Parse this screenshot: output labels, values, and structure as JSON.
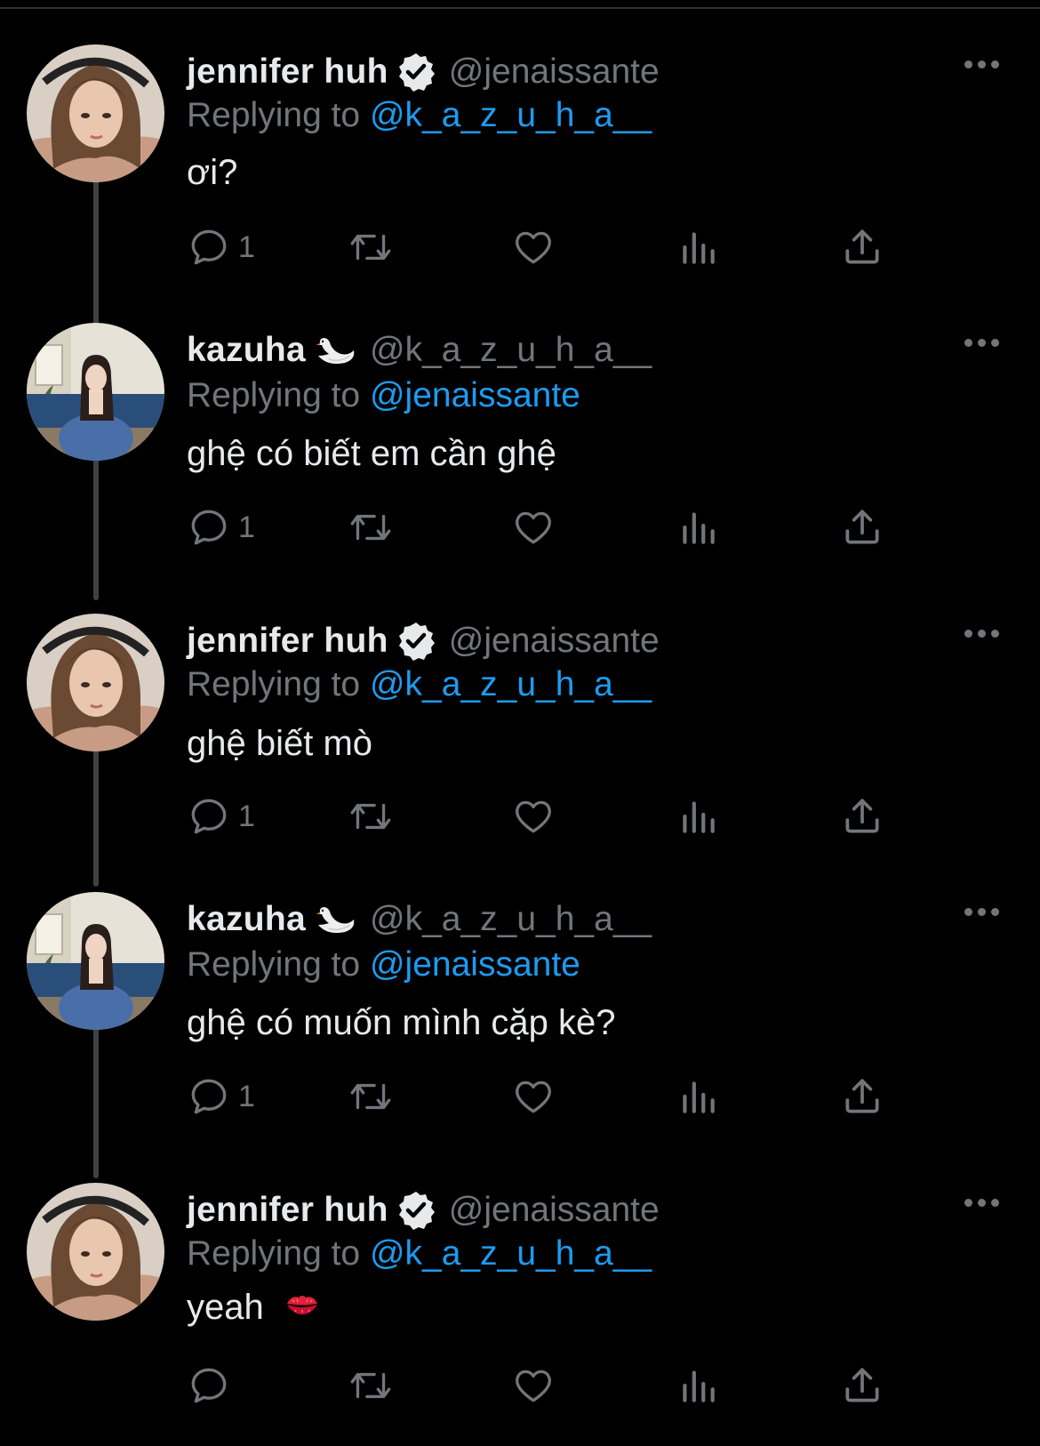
{
  "colors": {
    "background": "#000000",
    "text": "#e7e9ea",
    "muted": "#71767b",
    "accent": "#1d9bf0",
    "thread": "#3e4144"
  },
  "labels": {
    "replying_prefix": "Replying to"
  },
  "icons": [
    "verified-badge-icon",
    "swan-icon",
    "more-icon",
    "reply-icon",
    "retweet-icon",
    "like-icon",
    "views-icon",
    "share-icon",
    "kiss-icon"
  ],
  "tweets": [
    {
      "author": "jennifer huh",
      "handle": "@jenaissante",
      "replying_to": "@k_a_z_u_h_a__",
      "text": "ơi?",
      "reply_count": "1",
      "badge": "verified-badge-icon"
    },
    {
      "author": "kazuha",
      "handle": "@k_a_z_u_h_a__",
      "replying_to": "@jenaissante",
      "text": "ghệ có biết em cần ghệ",
      "reply_count": "1",
      "badge": "swan-icon"
    },
    {
      "author": "jennifer huh",
      "handle": "@jenaissante",
      "replying_to": "@k_a_z_u_h_a__",
      "text": "ghệ biết mò",
      "reply_count": "1",
      "badge": "verified-badge-icon"
    },
    {
      "author": "kazuha",
      "handle": "@k_a_z_u_h_a__",
      "replying_to": "@jenaissante",
      "text": "ghệ có muốn mình cặp kè?",
      "reply_count": "1",
      "badge": "swan-icon"
    },
    {
      "author": "jennifer huh",
      "handle": "@jenaissante",
      "replying_to": "@k_a_z_u_h_a__",
      "text": "yeah",
      "reply_count": "",
      "badge": "verified-badge-icon",
      "emoji": "kiss-icon"
    }
  ]
}
